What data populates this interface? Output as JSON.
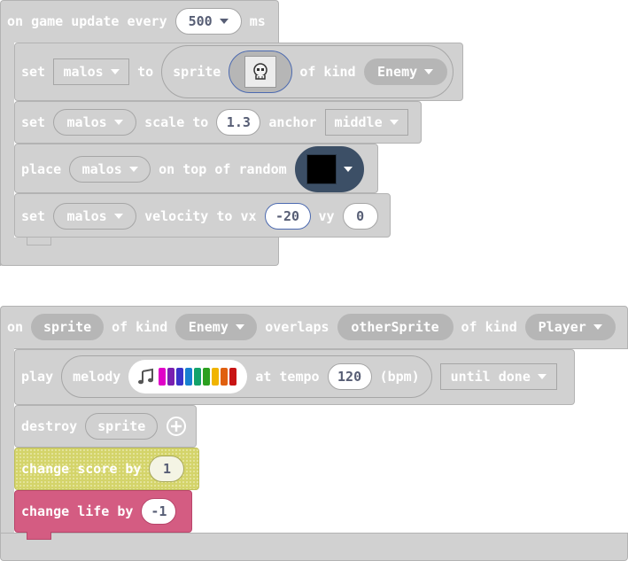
{
  "game_update": {
    "prefix": "on game update every",
    "interval": "500",
    "suffix": "ms"
  },
  "set_sprite": {
    "set": "set",
    "var": "malos",
    "to": "to",
    "sprite": "sprite",
    "of_kind": "of kind",
    "kind": "Enemy"
  },
  "set_scale": {
    "set": "set",
    "var": "malos",
    "scale_to": "scale to",
    "value": "1.3",
    "anchor": "anchor",
    "anchor_value": "middle"
  },
  "place": {
    "place": "place",
    "var": "malos",
    "text": "on top of random"
  },
  "set_velocity": {
    "set": "set",
    "var": "malos",
    "velocity_to": "velocity to vx",
    "vx": "-20",
    "vy_label": "vy",
    "vy": "0"
  },
  "overlap": {
    "on": "on",
    "sprite": "sprite",
    "of_kind": "of kind",
    "kind": "Enemy",
    "overlaps": "overlaps",
    "other": "otherSprite",
    "of_kind2": "of kind",
    "kind2": "Player"
  },
  "play": {
    "play": "play",
    "melody": "melody",
    "at_tempo": "at tempo",
    "tempo": "120",
    "bpm": "(bpm)",
    "mode": "until done",
    "notes": [
      "#e000c8",
      "#7a1fb0",
      "#3a34c9",
      "#1780d0",
      "#13a36b",
      "#2ba01f",
      "#f0b400",
      "#e06010",
      "#c81414"
    ]
  },
  "destroy": {
    "destroy": "destroy",
    "sprite": "sprite"
  },
  "score": {
    "text": "change score by",
    "value": "1"
  },
  "life": {
    "text": "change life by",
    "value": "-1"
  },
  "colors": {
    "sprites_block": "#d1d1d1",
    "info_score": "#d4d46a",
    "info_life": "#d45c82",
    "image_swatch": "#3c4f66"
  }
}
